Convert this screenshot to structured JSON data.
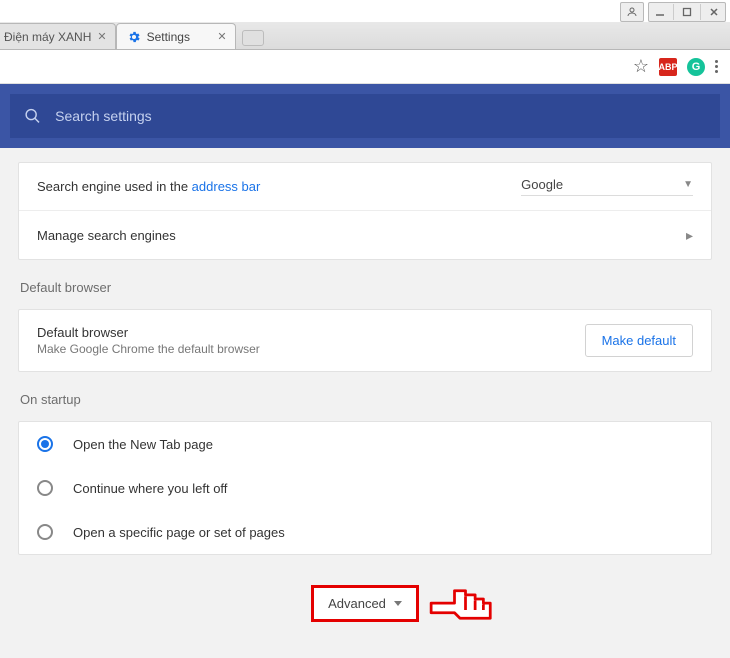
{
  "window_buttons": {
    "user": "",
    "min": "",
    "max": "",
    "close": ""
  },
  "tabs": [
    {
      "title": "Điện máy XANH"
    },
    {
      "title": "Settings"
    }
  ],
  "toolbar": {},
  "search_bar": {
    "placeholder": "Search settings"
  },
  "search_engine": {
    "label_prefix": "Search engine used in the ",
    "label_link": "address bar",
    "selected": "Google",
    "manage_label": "Manage search engines"
  },
  "default_browser": {
    "section_title": "Default browser",
    "title": "Default browser",
    "subtitle": "Make Google Chrome the default browser",
    "button": "Make default"
  },
  "startup": {
    "section_title": "On startup",
    "options": [
      "Open the New Tab page",
      "Continue where you left off",
      "Open a specific page or set of pages"
    ],
    "selected_index": 0
  },
  "advanced": {
    "label": "Advanced"
  }
}
